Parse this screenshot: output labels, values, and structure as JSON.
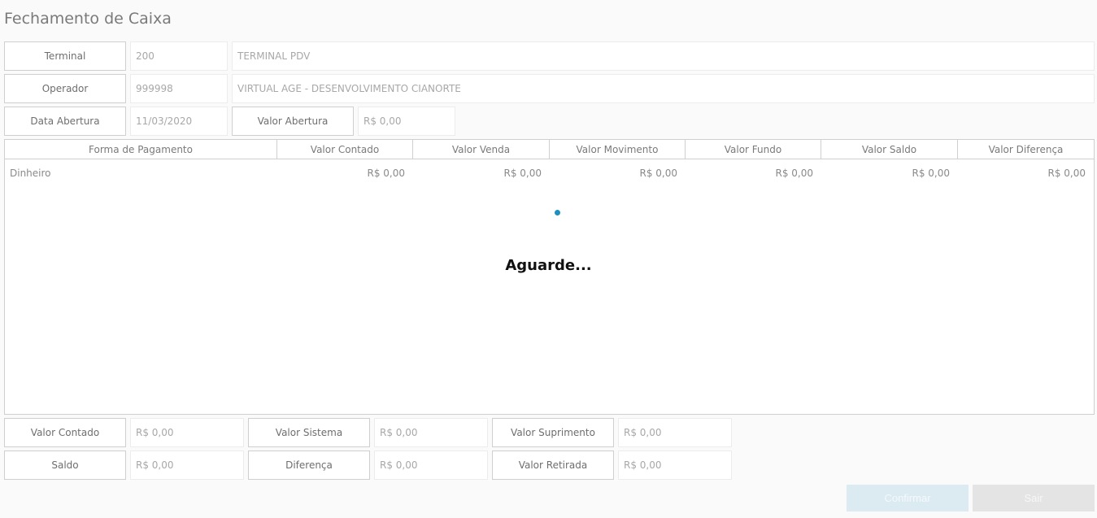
{
  "page": {
    "title": "Fechamento de Caixa"
  },
  "header": {
    "terminal": {
      "label": "Terminal",
      "code": "200",
      "name": "TERMINAL PDV"
    },
    "operador": {
      "label": "Operador",
      "code": "999998",
      "name": "VIRTUAL AGE - DESENVOLVIMENTO CIANORTE"
    },
    "data_abertura": {
      "label": "Data Abertura",
      "value": "11/03/2020"
    },
    "valor_abertura": {
      "label": "Valor Abertura",
      "value": "R$ 0,00"
    }
  },
  "grid": {
    "columns": [
      "Forma de Pagamento",
      "Valor Contado",
      "Valor Venda",
      "Valor Movimento",
      "Valor Fundo",
      "Valor Saldo",
      "Valor Diferença"
    ],
    "rows": [
      [
        "Dinheiro",
        "R$ 0,00",
        "R$ 0,00",
        "R$ 0,00",
        "R$ 0,00",
        "R$ 0,00",
        "R$ 0,00"
      ]
    ]
  },
  "loading": {
    "text": "Aguarde..."
  },
  "totals": {
    "valor_contado": {
      "label": "Valor Contado",
      "value": "R$ 0,00"
    },
    "valor_sistema": {
      "label": "Valor Sistema",
      "value": "R$ 0,00"
    },
    "valor_suprimento": {
      "label": "Valor Suprimento",
      "value": "R$ 0,00"
    },
    "saldo": {
      "label": "Saldo",
      "value": "R$ 0,00"
    },
    "diferenca": {
      "label": "Diferença",
      "value": "R$ 0,00"
    },
    "valor_retirada": {
      "label": "Valor Retirada",
      "value": "R$ 0,00"
    }
  },
  "buttons": {
    "confirm": "Confirmar",
    "exit": "Sair"
  },
  "colors": {
    "loader": "#1f8fbf",
    "confirm_bg": "#dcebf2",
    "exit_bg": "#e4e4e4"
  }
}
